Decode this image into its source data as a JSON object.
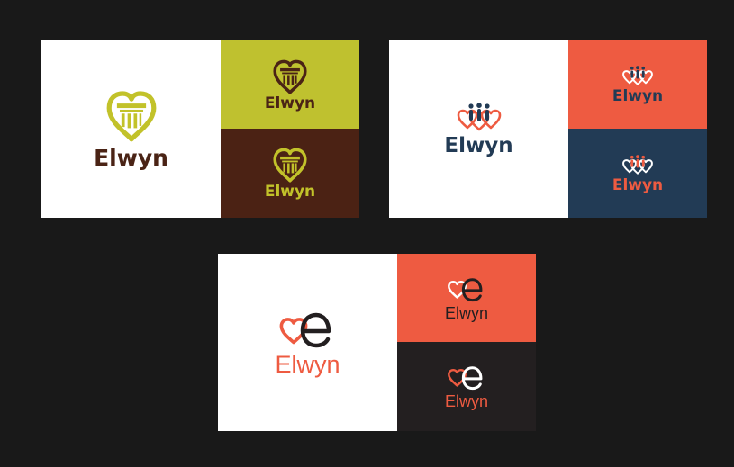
{
  "colors": {
    "background": "#191919",
    "panel_white": "#ffffff",
    "olive": "#bfc12f",
    "dark_brown": "#4b2214",
    "coral": "#ee5b41",
    "navy": "#223b55",
    "charcoal": "#231f20"
  },
  "boards": [
    {
      "concept": "heart-column",
      "wordmark": "Elwyn",
      "variants": [
        {
          "background": "#ffffff",
          "mark": "#c2c22a",
          "text": "#4a2315"
        },
        {
          "background": "#bfc12f",
          "mark": "#4a2315",
          "text": "#4a2315"
        },
        {
          "background": "#4b2214",
          "mark": "#c2c22a",
          "text": "#c2c22a"
        }
      ]
    },
    {
      "concept": "heart-figures",
      "wordmark": "Elwyn",
      "variants": [
        {
          "background": "#ffffff",
          "mark": "#ee5b41",
          "figures": "#223b55",
          "text": "#223b55"
        },
        {
          "background": "#ee5b41",
          "mark": "#ffffff",
          "figures": "#223b55",
          "text": "#223b55"
        },
        {
          "background": "#223b55",
          "mark": "#ffffff",
          "figures": "#ee5b41",
          "text": "#ee5b41"
        }
      ]
    },
    {
      "concept": "heart-letter-e",
      "wordmark": "Elwyn",
      "variants": [
        {
          "background": "#ffffff",
          "heart": "#ee5b41",
          "letter": "#231f20",
          "text": "#ee5b41"
        },
        {
          "background": "#ee5b41",
          "heart": "#ffffff",
          "letter": "#231f20",
          "text": "#231f20"
        },
        {
          "background": "#231f20",
          "heart": "#ee5b41",
          "letter": "#ffffff",
          "text": "#ee5b41"
        }
      ]
    }
  ]
}
